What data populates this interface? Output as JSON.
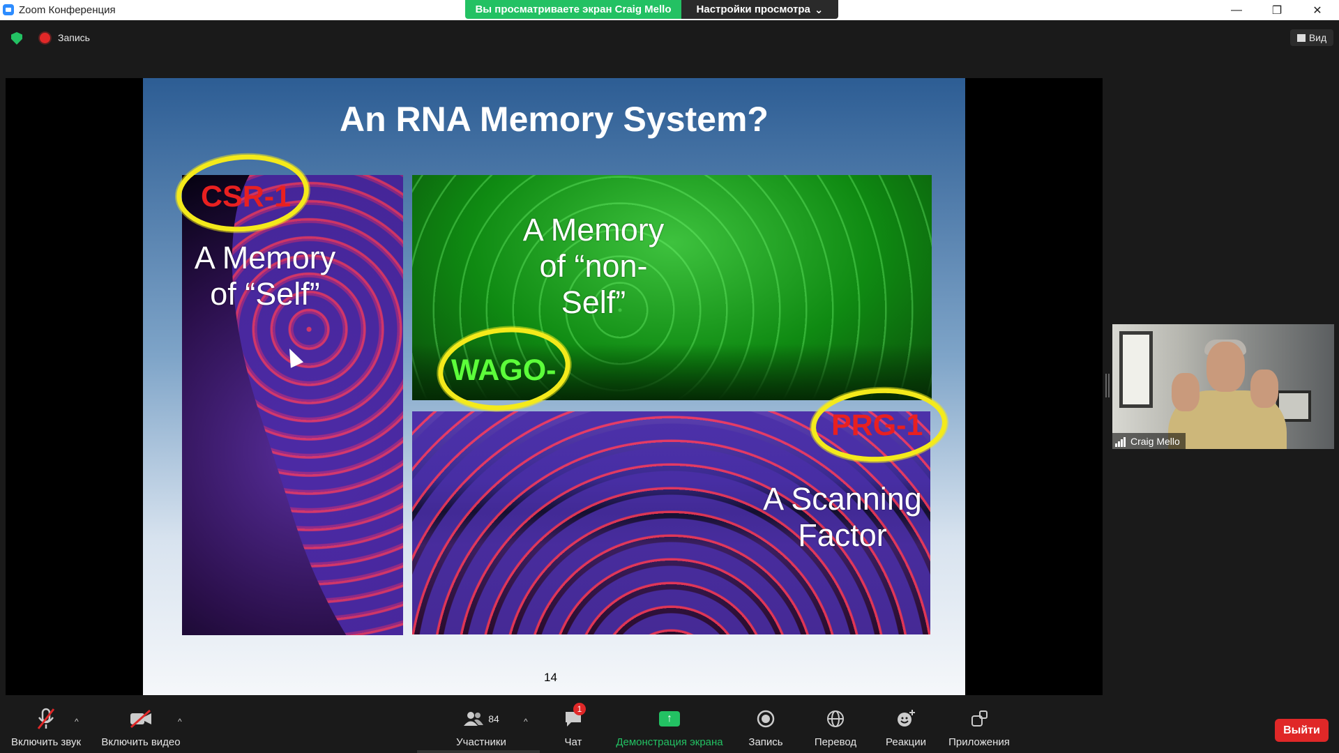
{
  "window": {
    "title": "Zoom Конференция",
    "minimize_glyph": "—",
    "restore_glyph": "❐",
    "close_glyph": "✕"
  },
  "share_banner": {
    "viewing_text": "Вы просматриваете экран Craig Mello",
    "view_options_label": "Настройки просмотра",
    "view_options_caret": "⌄"
  },
  "top_bar": {
    "recording_label": "Запись",
    "view_button_label": "Вид"
  },
  "slide": {
    "title": "An RNA Memory System?",
    "csr_label": "CSR-1",
    "self_text_line1": "A Memory",
    "self_text_line2": "of “Self”",
    "nonself_text_line1": "A Memory",
    "nonself_text_line2": "of “non-",
    "nonself_text_line3": "Self”",
    "wago_label": "WAGO-",
    "prg_label": "PRG-1",
    "scanning_line1": "A Scanning",
    "scanning_line2": "Factor",
    "page_number": "14"
  },
  "video": {
    "participant_name": "Craig Mello"
  },
  "toolbar": {
    "unmute_label": "Включить звук",
    "start_video_label": "Включить видео",
    "participants_label": "Участники",
    "participants_count": "84",
    "chat_label": "Чат",
    "chat_badge": "1",
    "share_label": "Демонстрация экрана",
    "record_label": "Запись",
    "translate_label": "Перевод",
    "reactions_label": "Реакции",
    "apps_label": "Приложения",
    "leave_label": "Выйти",
    "caret_glyph": "^",
    "share_glyph": "↑"
  },
  "colors": {
    "accent_green": "#23c163",
    "leave_red": "#e02828",
    "ring_yellow": "#f4ea1b",
    "csr_red": "#e82020",
    "wago_green": "#5cff3a"
  }
}
